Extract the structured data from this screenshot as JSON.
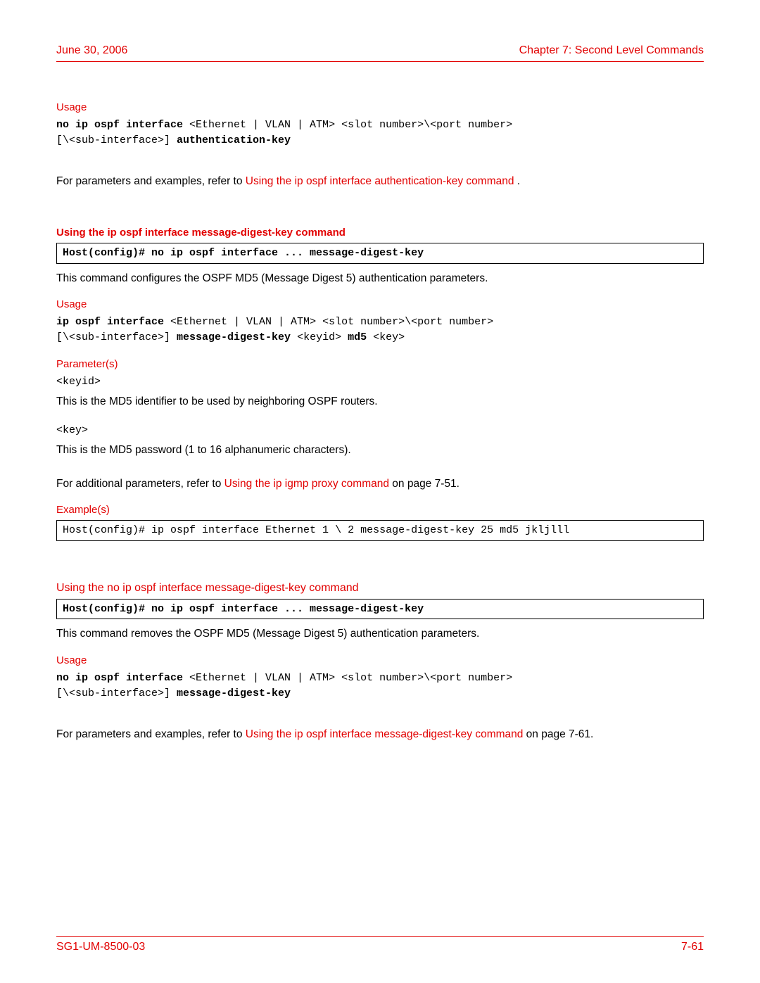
{
  "header": {
    "left": "June 30, 2006",
    "right": "Chapter 7: Second Level Commands"
  },
  "section1": {
    "usage_label": "Usage",
    "usage_code_b1": "no ip ospf interface ",
    "usage_code_n1": "<Ethernet | VLAN | ATM> <slot number>\\<port number>\n[\\<sub-interface>] ",
    "usage_code_b2": "authentication-key",
    "ref_prefix": "For parameters and examples, refer to  ",
    "ref_link": "Using the ip ospf interface authentication-key command",
    "ref_suffix": " ."
  },
  "section2": {
    "title": "Using the ip ospf interface message-digest-key command",
    "cmdbox": "Host(config)# no ip ospf interface ... message-digest-key",
    "desc": "This command configures the OSPF MD5 (Message Digest 5) authentication parameters.",
    "usage_label": "Usage",
    "usage_code_b1": "ip ospf interface ",
    "usage_code_n1": "<Ethernet | VLAN | ATM> <slot number>\\<port number>\n[\\<sub-interface>] ",
    "usage_code_b2": "message-digest-key ",
    "usage_code_n2": "<keyid> ",
    "usage_code_b3": "md5 ",
    "usage_code_n3": "<key>",
    "params_label": "Parameter(s)",
    "param1_name": "<keyid>",
    "param1_desc": "This is the MD5 identifier to be used by neighboring OSPF routers.",
    "param2_name": "<key>",
    "param2_desc": "This is the MD5 password (1 to 16 alphanumeric characters).",
    "addl_prefix": "For additional parameters, refer to  ",
    "addl_link": "Using the ip igmp proxy command",
    "addl_suffix": "  on page 7-51.",
    "examples_label": "Example(s)",
    "example_box": "Host(config)# ip ospf interface Ethernet 1 \\ 2 message-digest-key 25 md5 jkljlll"
  },
  "section3": {
    "title": "Using the no ip ospf interface message-digest-key command",
    "cmdbox": "Host(config)# no ip ospf interface ... message-digest-key",
    "desc": "This command removes the OSPF MD5 (Message Digest 5) authentication parameters.",
    "usage_label": "Usage",
    "usage_code_b1": "no ip ospf interface ",
    "usage_code_n1": "<Ethernet | VLAN | ATM> <slot number>\\<port number>\n[\\<sub-interface>] ",
    "usage_code_b2": "message-digest-key",
    "ref_prefix": "For parameters and examples, refer to  ",
    "ref_link": "Using the ip ospf interface message-digest-key command",
    "ref_suffix": "  on page 7-61."
  },
  "footer": {
    "left": "SG1-UM-8500-03",
    "right": "7-61"
  }
}
